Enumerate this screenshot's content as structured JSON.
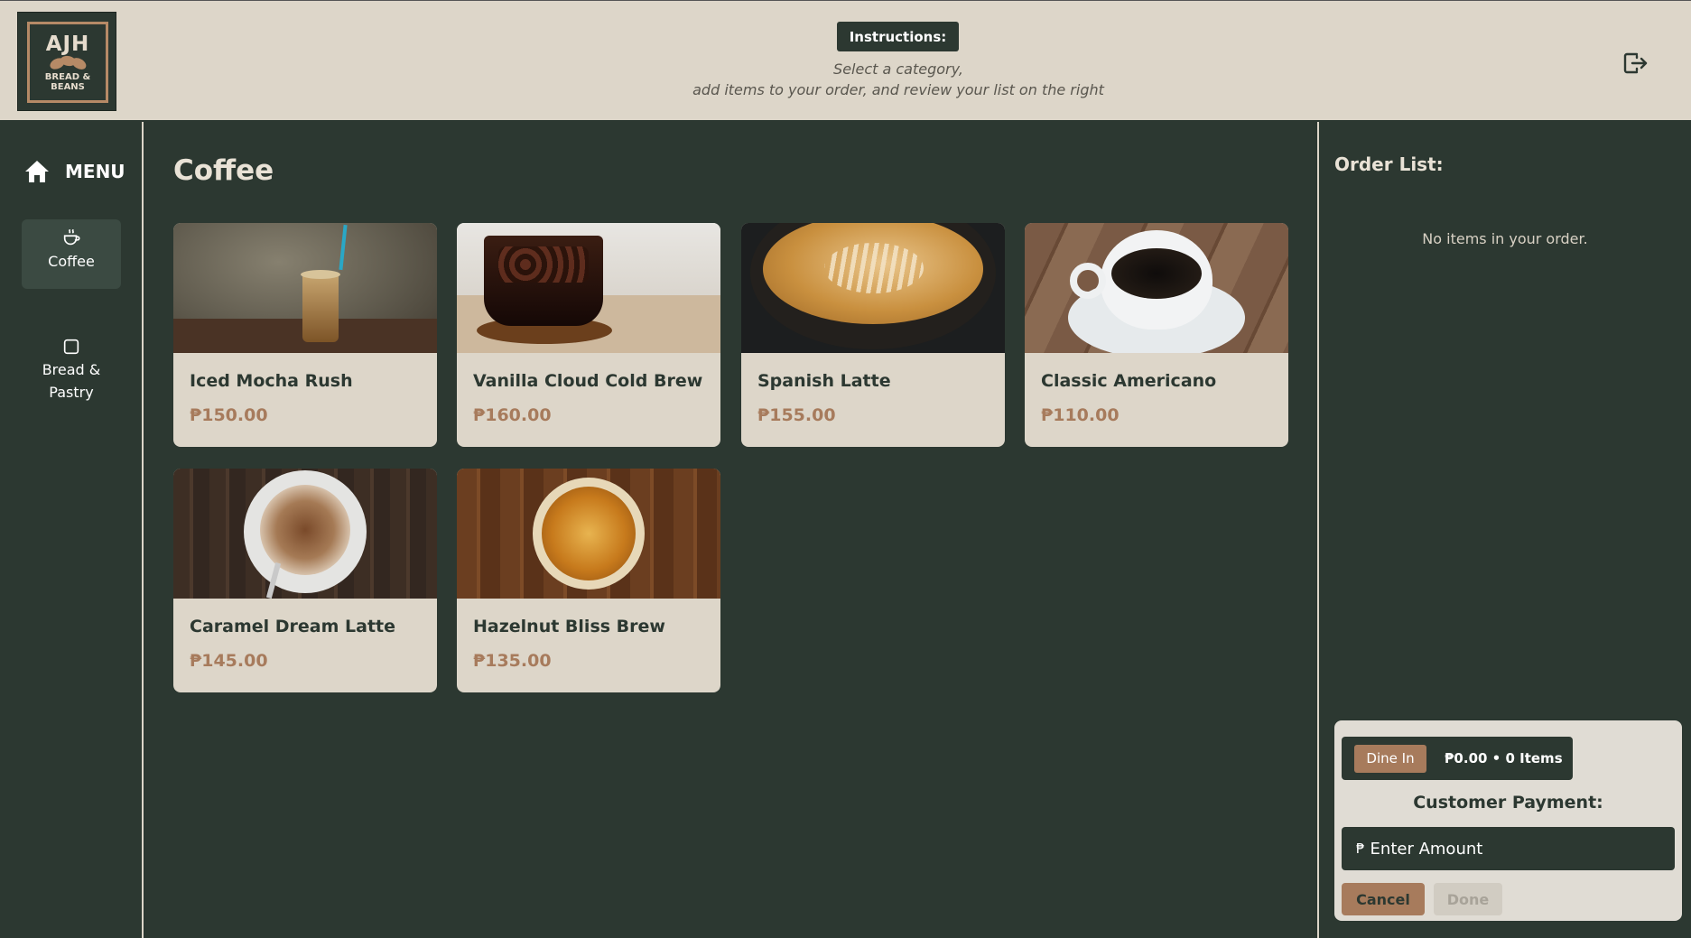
{
  "header": {
    "logo": {
      "title": "AJH",
      "subtitle_line1": "BREAD &",
      "subtitle_line2": "BEANS"
    },
    "instructions_label": "Instructions:",
    "instructions_line1": "Select a category,",
    "instructions_line2": "add items to your order, and review your list on the right",
    "logout_icon": "logout-icon"
  },
  "sidebar": {
    "menu_label": "MENU",
    "home_icon": "home-icon",
    "items": [
      {
        "label": "Coffee",
        "icon": "coffee-cup-icon",
        "active": true
      },
      {
        "label": "Bread & Pastry",
        "icon": "square-icon",
        "active": false
      }
    ]
  },
  "main": {
    "category_title": "Coffee",
    "products": [
      {
        "name": "Iced Mocha Rush",
        "price": "₱150.00"
      },
      {
        "name": "Vanilla Cloud Cold Brew",
        "price": "₱160.00"
      },
      {
        "name": "Spanish Latte",
        "price": "₱155.00"
      },
      {
        "name": "Classic Americano",
        "price": "₱110.00"
      },
      {
        "name": "Caramel Dream Latte",
        "price": "₱145.00"
      },
      {
        "name": "Hazelnut Bliss Brew",
        "price": "₱135.00"
      }
    ]
  },
  "order": {
    "title": "Order List:",
    "empty_message": "No items in your order.",
    "dine_mode": "Dine In",
    "summary": "₱0.00 • 0 Items",
    "payment_label": "Customer Payment:",
    "currency_symbol": "₱",
    "amount_placeholder": "Enter Amount",
    "cancel_label": "Cancel",
    "done_label": "Done"
  },
  "colors": {
    "dark_green": "#2c3831",
    "cream": "#ddd6c9",
    "accent_brown": "#a77b5c"
  }
}
